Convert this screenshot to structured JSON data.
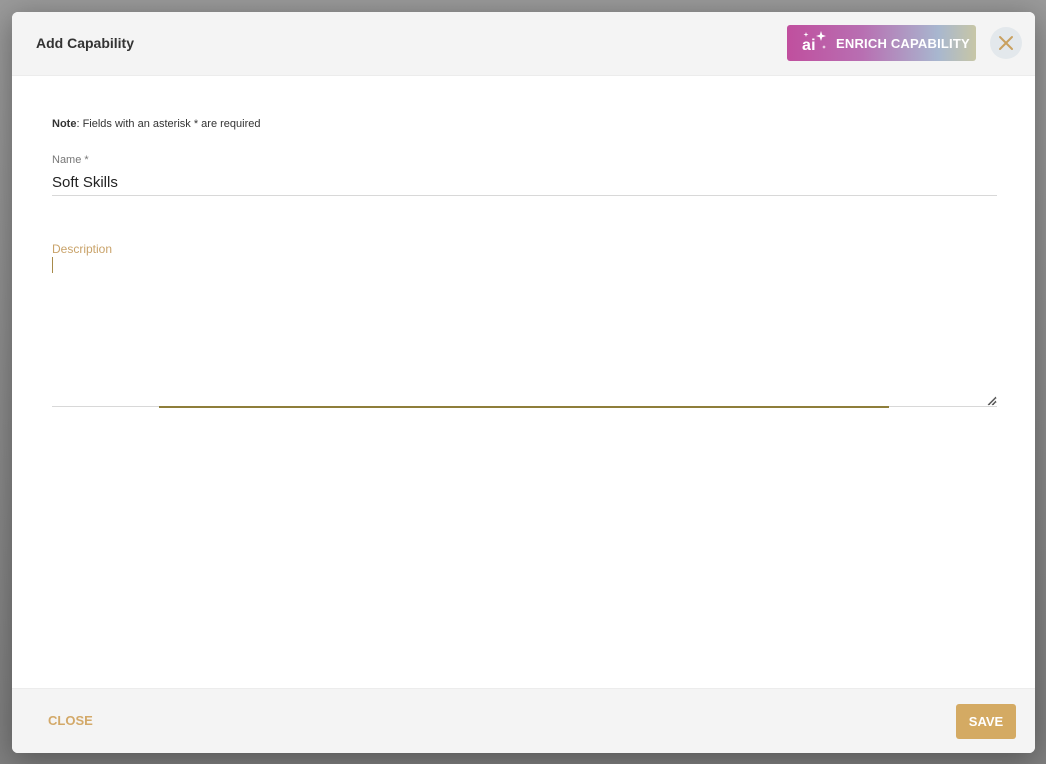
{
  "dialog": {
    "title": "Add Capability",
    "enrich_label": "ENRICH CAPABILITY",
    "enrich_icon": "ai-sparkle-icon",
    "enrich_gradient": [
      "#c04f9e",
      "#b86fb2",
      "#a8b7cf",
      "#c7c6a6"
    ],
    "close_icon": "close-icon",
    "accent_color": "#d4aa63"
  },
  "note": {
    "prefix": "Note",
    "text": ": Fields with an asterisk * are required"
  },
  "form": {
    "name": {
      "label": "Name *",
      "value": "Soft Skills"
    },
    "description": {
      "label": "Description",
      "value": ""
    }
  },
  "footer": {
    "close_label": "CLOSE",
    "save_label": "SAVE"
  }
}
